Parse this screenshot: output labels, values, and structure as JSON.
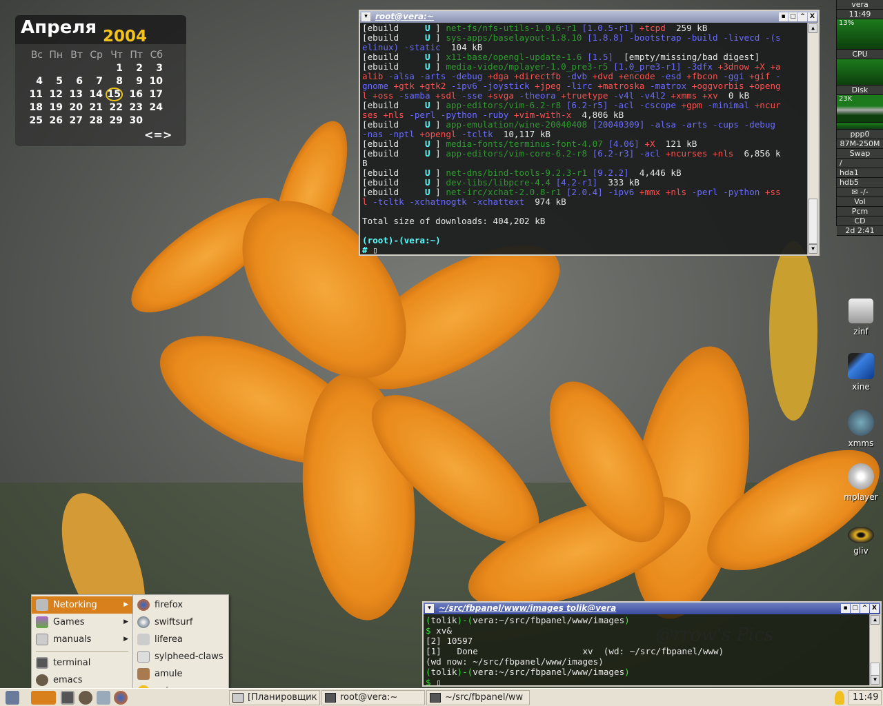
{
  "calendar": {
    "month": "Апреля",
    "year": "2004",
    "weekdays": [
      "Вс",
      "Пн",
      "Вт",
      "Ср",
      "Чт",
      "Пт",
      "Сб"
    ],
    "weeks": [
      [
        "",
        "",
        "",
        "",
        "1",
        "2",
        "3"
      ],
      [
        "4",
        "5",
        "6",
        "7",
        "8",
        "9",
        "10"
      ],
      [
        "11",
        "12",
        "13",
        "14",
        "15",
        "16",
        "17"
      ],
      [
        "18",
        "19",
        "20",
        "21",
        "22",
        "23",
        "24"
      ],
      [
        "25",
        "26",
        "27",
        "28",
        "29",
        "30",
        ""
      ]
    ],
    "today": "15",
    "nav": "<=>"
  },
  "terminal_root": {
    "title": "root@vera:~",
    "lines": [
      [
        [
          "w",
          "[ebuild     "
        ],
        [
          "c",
          "U"
        ],
        [
          "w",
          " ] "
        ],
        [
          "g",
          "net-fs/nfs-utils-1.0.6-r1"
        ],
        [
          "b",
          " [1.0.5-r1]"
        ],
        [
          "r",
          " +tcpd"
        ],
        [
          "w",
          "  259 kB"
        ]
      ],
      [
        [
          "w",
          "[ebuild     "
        ],
        [
          "c",
          "U"
        ],
        [
          "w",
          " ] "
        ],
        [
          "g",
          "sys-apps/baselayout-1.8.10"
        ],
        [
          "b",
          " [1.8.8] -bootstrap -build -livecd -(s"
        ]
      ],
      [
        [
          "b",
          "elinux) -static"
        ],
        [
          "w",
          "  104 kB"
        ]
      ],
      [
        [
          "w",
          "[ebuild     "
        ],
        [
          "c",
          "U"
        ],
        [
          "w",
          " ] "
        ],
        [
          "g",
          "x11-base/opengl-update-1.6"
        ],
        [
          "b",
          " [1.5]"
        ],
        [
          "w",
          "  [empty/missing/bad digest]"
        ]
      ],
      [
        [
          "w",
          "[ebuild     "
        ],
        [
          "c",
          "U"
        ],
        [
          "w",
          " ] "
        ],
        [
          "g",
          "media-video/mplayer-1.0_pre3-r5"
        ],
        [
          "b",
          " [1.0_pre3-r1] -3dfx"
        ],
        [
          "r",
          " +3dnow +X +a"
        ]
      ],
      [
        [
          "r",
          "alib"
        ],
        [
          "b",
          " -alsa -arts -debug"
        ],
        [
          "r",
          " +dga +directfb"
        ],
        [
          "b",
          " -dvb"
        ],
        [
          "r",
          " +dvd +encode"
        ],
        [
          "b",
          " -esd"
        ],
        [
          "r",
          " +fbcon"
        ],
        [
          "b",
          " -ggi"
        ],
        [
          "r",
          " +gif"
        ],
        [
          "b",
          " -"
        ]
      ],
      [
        [
          "b",
          "gnome"
        ],
        [
          "r",
          " +gtk +gtk2"
        ],
        [
          "b",
          " -ipv6 -joystick"
        ],
        [
          "r",
          " +jpeg"
        ],
        [
          "b",
          " -lirc"
        ],
        [
          "r",
          " +matroska"
        ],
        [
          "b",
          " -matrox"
        ],
        [
          "r",
          " +oggvorbis +openg"
        ]
      ],
      [
        [
          "r",
          "l +oss"
        ],
        [
          "b",
          " -samba"
        ],
        [
          "r",
          " +sdl"
        ],
        [
          "b",
          " -sse"
        ],
        [
          "r",
          " +svga"
        ],
        [
          "b",
          " -theora"
        ],
        [
          "r",
          " +truetype"
        ],
        [
          "b",
          " -v4l -v4l2"
        ],
        [
          "r",
          " +xmms +xv"
        ],
        [
          "w",
          "  0 kB"
        ]
      ],
      [
        [
          "w",
          "[ebuild     "
        ],
        [
          "c",
          "U"
        ],
        [
          "w",
          " ] "
        ],
        [
          "g",
          "app-editors/vim-6.2-r8"
        ],
        [
          "b",
          " [6.2-r5] -acl -cscope"
        ],
        [
          "r",
          " +gpm"
        ],
        [
          "b",
          " -minimal"
        ],
        [
          "r",
          " +ncur"
        ]
      ],
      [
        [
          "r",
          "ses +nls"
        ],
        [
          "b",
          " -perl -python -ruby"
        ],
        [
          "r",
          " +vim-with-x"
        ],
        [
          "w",
          "  4,806 kB"
        ]
      ],
      [
        [
          "w",
          "[ebuild     "
        ],
        [
          "c",
          "U"
        ],
        [
          "w",
          " ] "
        ],
        [
          "g",
          "app-emulation/wine-20040408"
        ],
        [
          "b",
          " [20040309] -alsa -arts -cups -debug"
        ]
      ],
      [
        [
          "b",
          "-nas -nptl"
        ],
        [
          "r",
          " +opengl"
        ],
        [
          "b",
          " -tcltk"
        ],
        [
          "w",
          "  10,117 kB"
        ]
      ],
      [
        [
          "w",
          "[ebuild     "
        ],
        [
          "c",
          "U"
        ],
        [
          "w",
          " ] "
        ],
        [
          "g",
          "media-fonts/terminus-font-4.07"
        ],
        [
          "b",
          " [4.06]"
        ],
        [
          "r",
          " +X"
        ],
        [
          "w",
          "  121 kB"
        ]
      ],
      [
        [
          "w",
          "[ebuild     "
        ],
        [
          "c",
          "U"
        ],
        [
          "w",
          " ] "
        ],
        [
          "g",
          "app-editors/vim-core-6.2-r8"
        ],
        [
          "b",
          " [6.2-r3] -acl"
        ],
        [
          "r",
          " +ncurses +nls"
        ],
        [
          "w",
          "  6,856 k"
        ]
      ],
      [
        [
          "w",
          "B"
        ]
      ],
      [
        [
          "w",
          "[ebuild     "
        ],
        [
          "c",
          "U"
        ],
        [
          "w",
          " ] "
        ],
        [
          "g",
          "net-dns/bind-tools-9.2.3-r1"
        ],
        [
          "b",
          " [9.2.2]"
        ],
        [
          "w",
          "  4,446 kB"
        ]
      ],
      [
        [
          "w",
          "[ebuild     "
        ],
        [
          "c",
          "U"
        ],
        [
          "w",
          " ] "
        ],
        [
          "g",
          "dev-libs/libpcre-4.4"
        ],
        [
          "b",
          " [4.2-r1]"
        ],
        [
          "w",
          "  333 kB"
        ]
      ],
      [
        [
          "w",
          "[ebuild     "
        ],
        [
          "c",
          "U"
        ],
        [
          "w",
          " ] "
        ],
        [
          "g",
          "net-irc/xchat-2.0.8-r1"
        ],
        [
          "b",
          " [2.0.4] -ipv6"
        ],
        [
          "r",
          " +mmx +nls"
        ],
        [
          "b",
          " -perl -python"
        ],
        [
          "r",
          " +ss"
        ]
      ],
      [
        [
          "r",
          "l"
        ],
        [
          "b",
          " -tcltk -xchatnogtk -xchattext"
        ],
        [
          "w",
          "  974 kB"
        ]
      ],
      [
        [
          "w",
          " "
        ]
      ],
      [
        [
          "w",
          "Total size of downloads: 404,202 kB"
        ]
      ],
      [
        [
          "w",
          " "
        ]
      ],
      [
        [
          "c",
          "(root)-(vera:~)"
        ]
      ],
      [
        [
          "c",
          "# "
        ],
        [
          "w",
          "▯"
        ]
      ]
    ]
  },
  "terminal_tolik": {
    "title": "~/src/fbpanel/www/images tolik@vera",
    "watermark": "@rrow's Pics",
    "lines": [
      [
        [
          "lg",
          "("
        ],
        [
          "w",
          "tolik"
        ],
        [
          "lg",
          ")-("
        ],
        [
          "w",
          "vera:~/src/fbpanel/www/images"
        ],
        [
          "lg",
          ")"
        ]
      ],
      [
        [
          "lg",
          "$"
        ],
        [
          "w",
          " xv&"
        ]
      ],
      [
        [
          "w",
          "[2] 10597"
        ]
      ],
      [
        [
          "w",
          "[1]   Done                    xv  (wd: ~/src/fbpanel/www)"
        ]
      ],
      [
        [
          "w",
          "(wd now: ~/src/fbpanel/www/images)"
        ]
      ],
      [
        [
          "lg",
          "("
        ],
        [
          "w",
          "tolik"
        ],
        [
          "lg",
          ")-("
        ],
        [
          "w",
          "vera:~/src/fbpanel/www/images"
        ],
        [
          "lg",
          ")"
        ]
      ],
      [
        [
          "lg",
          "$ "
        ],
        [
          "w",
          "▯"
        ]
      ]
    ]
  },
  "window_buttons": {
    "menu": "▾",
    "minimize": "▪",
    "maximize": "□",
    "shade": "^",
    "close": "X"
  },
  "gkrellm": {
    "host": "vera",
    "time": "11:49",
    "cpu_value": "13%",
    "cpu_label": "CPU",
    "disk_label": "Disk",
    "disk_value": "23K",
    "net_iface": "ppp0",
    "net_traffic": "87M-250M",
    "swap_label": "Swap",
    "fs": [
      "/",
      "hda1",
      "hdb5"
    ],
    "mail": "-/-",
    "mixer": [
      "Vol",
      "Pcm",
      "CD"
    ],
    "uptime": "2d  2:41"
  },
  "desktop_icons": [
    {
      "label": "zinf"
    },
    {
      "label": "xine"
    },
    {
      "label": "xmms"
    },
    {
      "label": "mplayer"
    },
    {
      "label": "gliv"
    }
  ],
  "menu": {
    "items": [
      {
        "label": "Netorking",
        "submenu": true
      },
      {
        "label": "Games",
        "submenu": true
      },
      {
        "label": "manuals",
        "submenu": true
      },
      {
        "label": "terminal"
      },
      {
        "label": "emacs"
      }
    ],
    "submenu": [
      {
        "label": "firefox"
      },
      {
        "label": "swiftsurf"
      },
      {
        "label": "liferea"
      },
      {
        "label": "sylpheed-claws"
      },
      {
        "label": "amule"
      },
      {
        "label": "gaim"
      }
    ]
  },
  "taskbar": {
    "tasks": [
      {
        "label": "[Планировщик за"
      },
      {
        "label": "root@vera:~"
      },
      {
        "label": "~/src/fbpanel/ww"
      }
    ],
    "clock": "11:49"
  },
  "colors": {
    "menu_highlight": "#d7801c",
    "year": "#f3c21b",
    "today_ring": "#e8c21a"
  }
}
